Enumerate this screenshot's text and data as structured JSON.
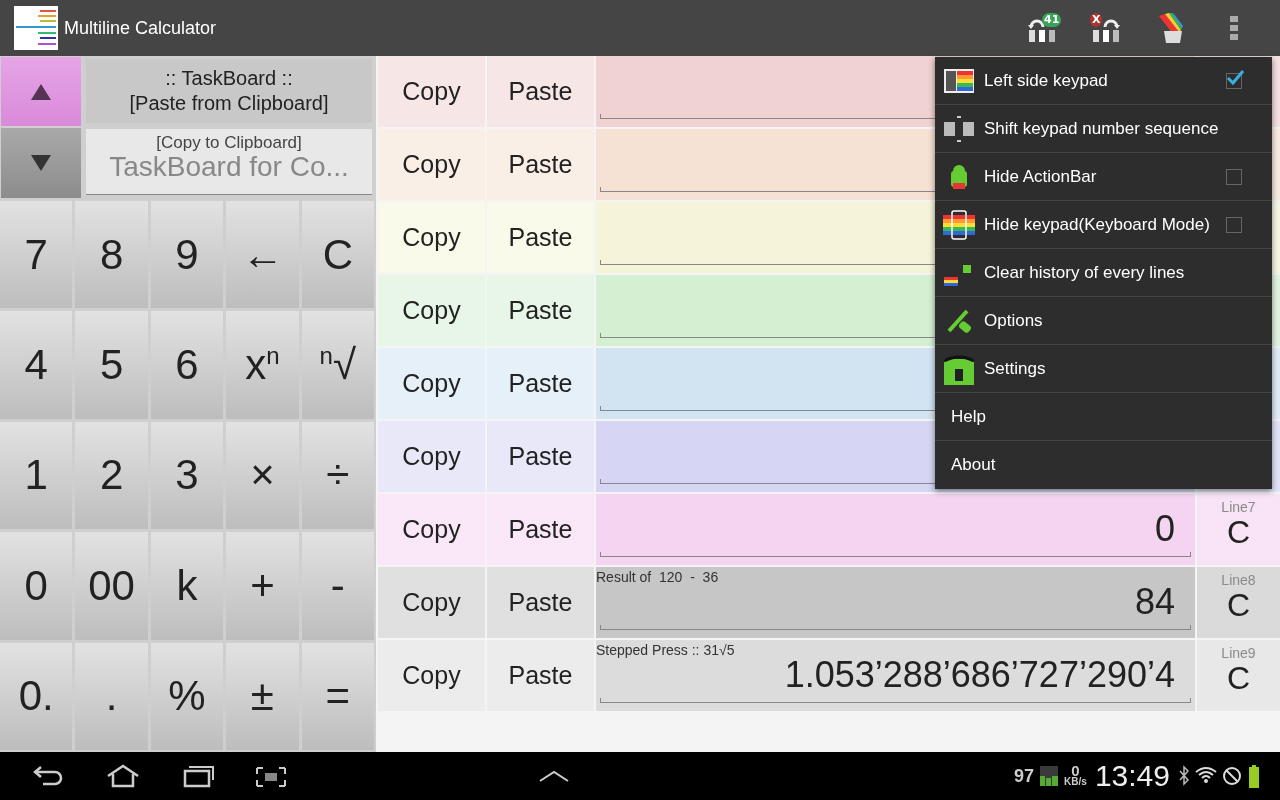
{
  "action_bar": {
    "title": "Multiline Calculator",
    "undo_badge": "41",
    "redo_badge": "X"
  },
  "taskboard": {
    "paste_button": [
      ":: TaskBoard ::",
      "[Paste from Clipboard]"
    ],
    "copy_label": "[Copy to Clipboard]",
    "copy_value": "TaskBoard for Co..."
  },
  "keypad": [
    "7",
    "8",
    "9",
    "←",
    "C",
    "4",
    "5",
    "6",
    "x$^{n}$",
    "$^{n}$√",
    "1",
    "2",
    "3",
    "×",
    "÷",
    "0",
    "00",
    "k",
    "+",
    "-",
    "0.",
    ".",
    "%",
    "±",
    "="
  ],
  "lines": [
    {
      "color": "#f0d2d2",
      "copy": "Copy",
      "paste": "Paste"
    },
    {
      "color": "#f6e2d4",
      "copy": "Copy",
      "paste": "Paste"
    },
    {
      "color": "#f5f4d8",
      "copy": "Copy",
      "paste": "Paste"
    },
    {
      "color": "#d4efd2",
      "copy": "Copy",
      "paste": "Paste"
    },
    {
      "color": "#d2e4f2",
      "copy": "Copy",
      "paste": "Paste"
    },
    {
      "color": "#d6d6f4",
      "copy": "Copy",
      "paste": "Paste"
    },
    {
      "color": "#f5d4f2",
      "copy": "Copy",
      "paste": "Paste",
      "value": "0",
      "line_label": "Line7",
      "clear": "C"
    },
    {
      "color": "#c6c6c6",
      "copy": "Copy",
      "paste": "Paste",
      "note": "Result of  120  -  36",
      "value": "84",
      "line_label": "Line8",
      "clear": "C"
    },
    {
      "color": "#dcdcdc",
      "copy": "Copy",
      "paste": "Paste",
      "note": "Stepped Press :: 31√5",
      "value": "1.053’288’686’727’290’4",
      "line_label": "Line9",
      "clear": "C"
    }
  ],
  "menu": [
    {
      "kind": "toggle",
      "label": "Left side keypad",
      "checked": true
    },
    {
      "kind": "action",
      "label": "Shift keypad number sequence"
    },
    {
      "kind": "toggle",
      "label": "Hide ActionBar",
      "checked": false
    },
    {
      "kind": "toggle",
      "label": "Hide keypad(Keyboard Mode)",
      "checked": false
    },
    {
      "kind": "action",
      "label": "Clear history of every lines"
    },
    {
      "kind": "action",
      "label": "Options"
    },
    {
      "kind": "action",
      "label": "Settings"
    },
    {
      "kind": "link",
      "label": "Help"
    },
    {
      "kind": "link",
      "label": "About"
    }
  ],
  "status_bar": {
    "battery_percent": "97",
    "speed_value": "0",
    "speed_unit": "KB/s",
    "time": "13:49"
  }
}
